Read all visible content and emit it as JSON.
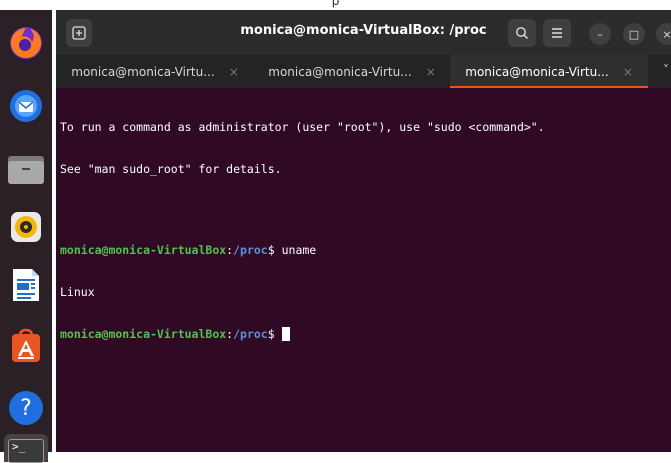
{
  "topbar": {
    "text": "p"
  },
  "dock": {
    "items": [
      {
        "name": "firefox"
      },
      {
        "name": "thunderbird"
      },
      {
        "name": "files"
      },
      {
        "name": "rhythmbox"
      },
      {
        "name": "libreoffice-writer"
      },
      {
        "name": "app-center"
      },
      {
        "name": "help",
        "glyph": "?"
      },
      {
        "name": "terminal",
        "glyph": ">_"
      }
    ]
  },
  "window": {
    "title": "monica@monica-VirtualBox: /proc",
    "tabs": [
      {
        "label": "monica@monica-Virtu...",
        "close": "×"
      },
      {
        "label": "monica@monica-Virtu...",
        "close": "×"
      },
      {
        "label": "monica@monica-Virtu...",
        "close": "×"
      }
    ],
    "tabs_overflow": "˅",
    "minimize_glyph": "–",
    "maximize_glyph": "□",
    "close_glyph": "×"
  },
  "terminal": {
    "notice1": "To run a command as administrator (user \"root\"), use \"sudo <command>\".",
    "notice2": "See \"man sudo_root\" for details.",
    "user": "monica@monica-VirtualBox",
    "colon": ":",
    "path": "/proc",
    "dollar": "$",
    "cmd1": " uname",
    "out1": "Linux"
  },
  "colors": {
    "terminal_bg": "#300a24",
    "prompt_user": "#4ec34e",
    "prompt_path": "#5e8fd6",
    "accent": "#e95420"
  }
}
